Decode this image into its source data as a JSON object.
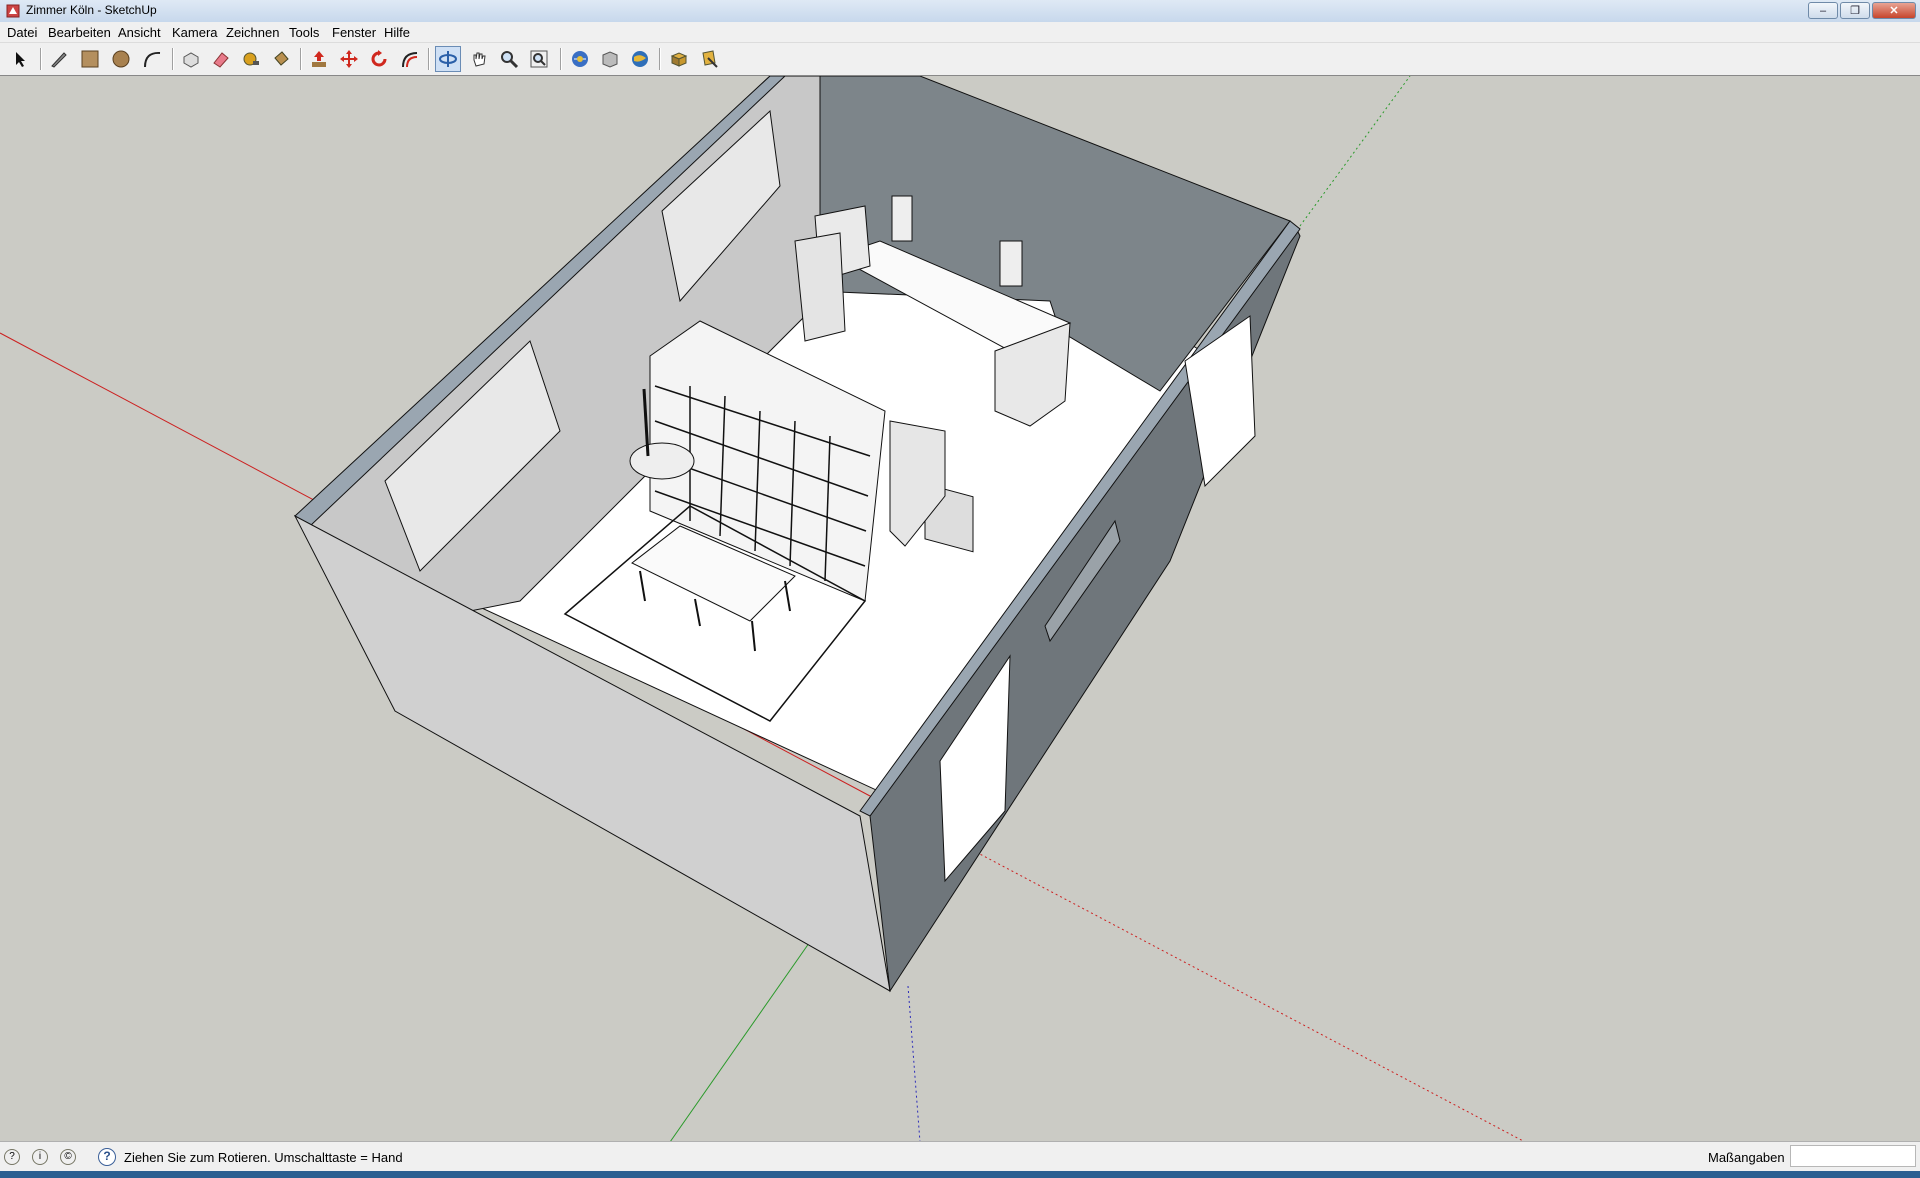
{
  "window": {
    "title": "Zimmer Köln - SketchUp",
    "buttons": [
      "–",
      "❐",
      "✕"
    ]
  },
  "menu": [
    "Datei",
    "Bearbeiten",
    "Ansicht",
    "Kamera",
    "Zeichnen",
    "Tools",
    "Fenster",
    "Hilfe"
  ],
  "toolbar": {
    "tools": [
      "select-tool",
      "line-tool",
      "rectangle-tool",
      "circle-tool",
      "arc-tool",
      "make-component-tool",
      "eraser-tool",
      "tape-measure-tool",
      "paint-bucket-tool",
      "push-pull-tool",
      "move-tool",
      "rotate-tool",
      "offset-tool",
      "orbit-tool",
      "pan-tool",
      "zoom-tool",
      "zoom-extents-tool",
      "get-models-tool",
      "share-model-tool",
      "google-earth-tool",
      "component-tool",
      "section-tool"
    ],
    "active": "orbit-tool"
  },
  "status": {
    "message": "Ziehen Sie zum Rotieren.  Umschalttaste = Hand",
    "measure_label": "Maßangaben",
    "measure_value": ""
  },
  "colors": {
    "viewport": "#cbcbc5",
    "red_axis": "#cc2020",
    "green_axis": "#2a9a2a",
    "blue_axis": "#2b2bb8"
  }
}
